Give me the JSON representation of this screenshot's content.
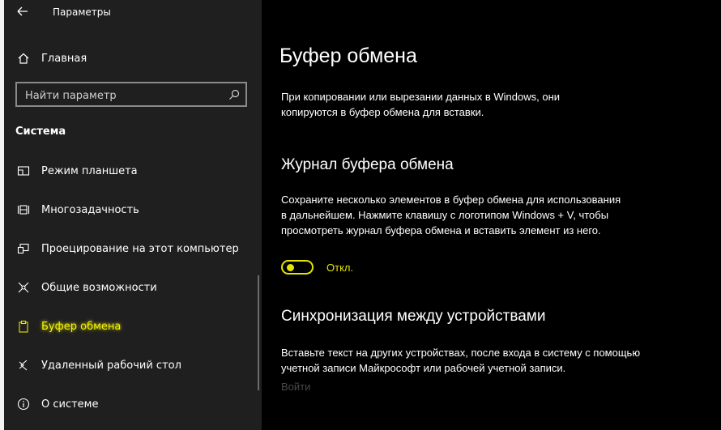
{
  "window": {
    "title": "Параметры",
    "back_label": "←"
  },
  "sidebar": {
    "home_label": "Главная",
    "search": {
      "placeholder": "Найти параметр"
    },
    "section": "Система",
    "items": [
      {
        "label": "Режим планшета",
        "icon": "tablet-mode-icon"
      },
      {
        "label": "Многозадачность",
        "icon": "multitasking-icon"
      },
      {
        "label": "Проецирование на этот компьютер",
        "icon": "projecting-icon"
      },
      {
        "label": "Общие возможности",
        "icon": "shared-experiences-icon"
      },
      {
        "label": "Буфер обмена",
        "icon": "clipboard-icon",
        "selected": true
      },
      {
        "label": "Удаленный рабочий стол",
        "icon": "remote-desktop-icon"
      },
      {
        "label": "О системе",
        "icon": "about-icon"
      }
    ]
  },
  "main": {
    "title": "Буфер обмена",
    "intro": "При копировании или вырезании данных в Windows, они копируются в буфер обмена для вставки.",
    "history": {
      "heading": "Журнал буфера обмена",
      "description": "Сохраните несколько элементов в буфер обмена для использования в дальнейшем. Нажмите клавишу с логотипом Windows + V, чтобы просмотреть журнал буфера обмена и вставить элемент из него.",
      "toggle_state": "Откл.",
      "toggle_on": false
    },
    "sync": {
      "heading": "Синхронизация между устройствами",
      "description": "Вставьте текст на других устройствах, после входа в систему с помощью учетной записи Майкрософт или рабочей учетной записи.",
      "signin_label": "Войти"
    }
  },
  "colors": {
    "accent": "#e6e400",
    "sidebar_bg": "#1f1f1f",
    "main_bg": "#000000"
  }
}
